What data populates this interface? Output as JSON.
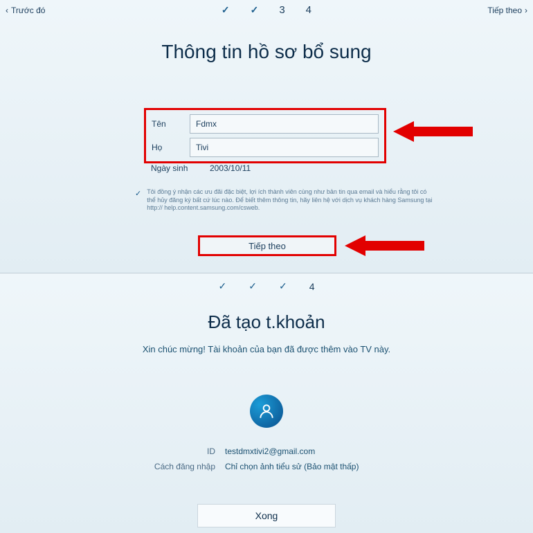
{
  "screen1": {
    "back_label": "Trước đó",
    "next_label": "Tiếp theo",
    "steps": {
      "s1": "✓",
      "s2": "✓",
      "s3": "3",
      "s4": "4"
    },
    "title": "Thông tin hồ sơ bổ sung",
    "fields": {
      "firstname_label": "Tên",
      "firstname_value": "Fdmx",
      "lastname_label": "Họ",
      "lastname_value": "Tivi",
      "dob_label": "Ngày sinh",
      "dob_value": "2003/10/11"
    },
    "consent_text": "Tôi đồng ý nhận các ưu đãi đặc biệt, lợi ích thành viên cùng như bản tin qua email và hiểu rằng tôi có thể hủy đăng ký bất cứ lúc nào. Để biết thêm thông tin, hãy liên hệ với dịch vụ khách hàng Samsung tại http:// help.content.samsung.com/csweb.",
    "next_button": "Tiếp theo"
  },
  "screen2": {
    "steps": {
      "s1": "✓",
      "s2": "✓",
      "s3": "✓",
      "s4": "4"
    },
    "title": "Đã tạo t.khoản",
    "subtitle": "Xin chúc mừng! Tài khoản của bạn đã được thêm vào TV này.",
    "info": {
      "id_label": "ID",
      "id_value": "testdmxtivi2@gmail.com",
      "login_label": "Cách đăng nhập",
      "login_value": "Chỉ chọn ảnh tiểu sử (Bảo mật thấp)"
    },
    "done_button": "Xong"
  }
}
